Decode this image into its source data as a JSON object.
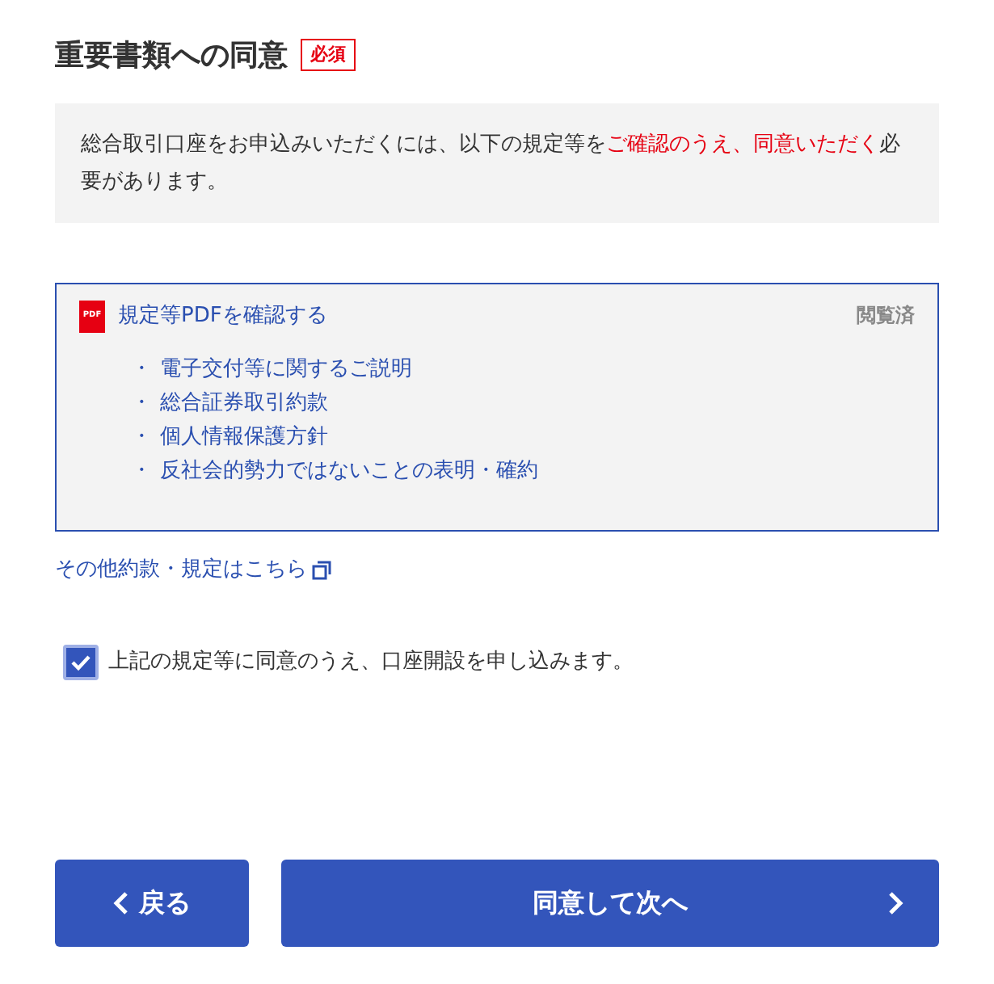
{
  "heading": {
    "title": "重要書類への同意",
    "badge": "必須"
  },
  "notice": {
    "text": "総合取引口座をお申込みいただくには、以下の規定等を",
    "highlight": "ご確認のうえ、同意いただく",
    "tail": "必要があります。"
  },
  "documents": {
    "icon_label": "PDF",
    "link": "規定等PDFを確認する",
    "status": "閲覧済",
    "items": [
      {
        "bullet": "・",
        "text": "電子交付等に関するご説明"
      },
      {
        "bullet": "・",
        "text": "総合証券取引約款"
      },
      {
        "bullet": "・",
        "text": "個人情報保護方針"
      },
      {
        "bullet": "・",
        "text": "反社会的勢力ではないことの表明・確約"
      }
    ]
  },
  "other_link": "その他約款・規定はこちら",
  "agreement": {
    "label": "上記の規定等に同意のうえ、口座開設を申し込みます。",
    "checked": true
  },
  "buttons": {
    "back": "戻る",
    "next": "同意して次へ"
  }
}
